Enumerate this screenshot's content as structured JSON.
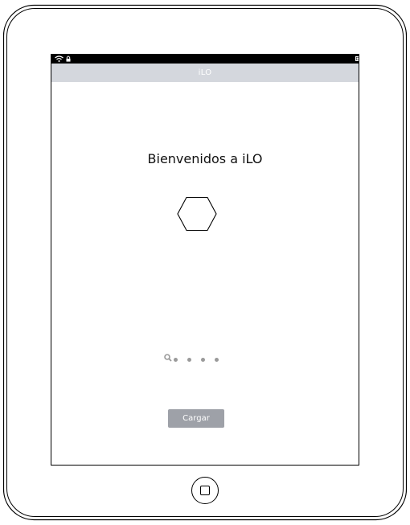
{
  "navbar": {
    "title": "iLO"
  },
  "main": {
    "welcome_text": "Bienvenidos a iLO",
    "logo_icon": "hexagon-icon",
    "pager": {
      "search_icon": "search-icon",
      "dot_count": 4
    },
    "load_button_label": "Cargar"
  },
  "statusbar": {
    "icons": [
      "wifi-icon",
      "lock-icon",
      "battery-icon"
    ]
  },
  "device": {
    "home_icon": "home-button-icon"
  }
}
